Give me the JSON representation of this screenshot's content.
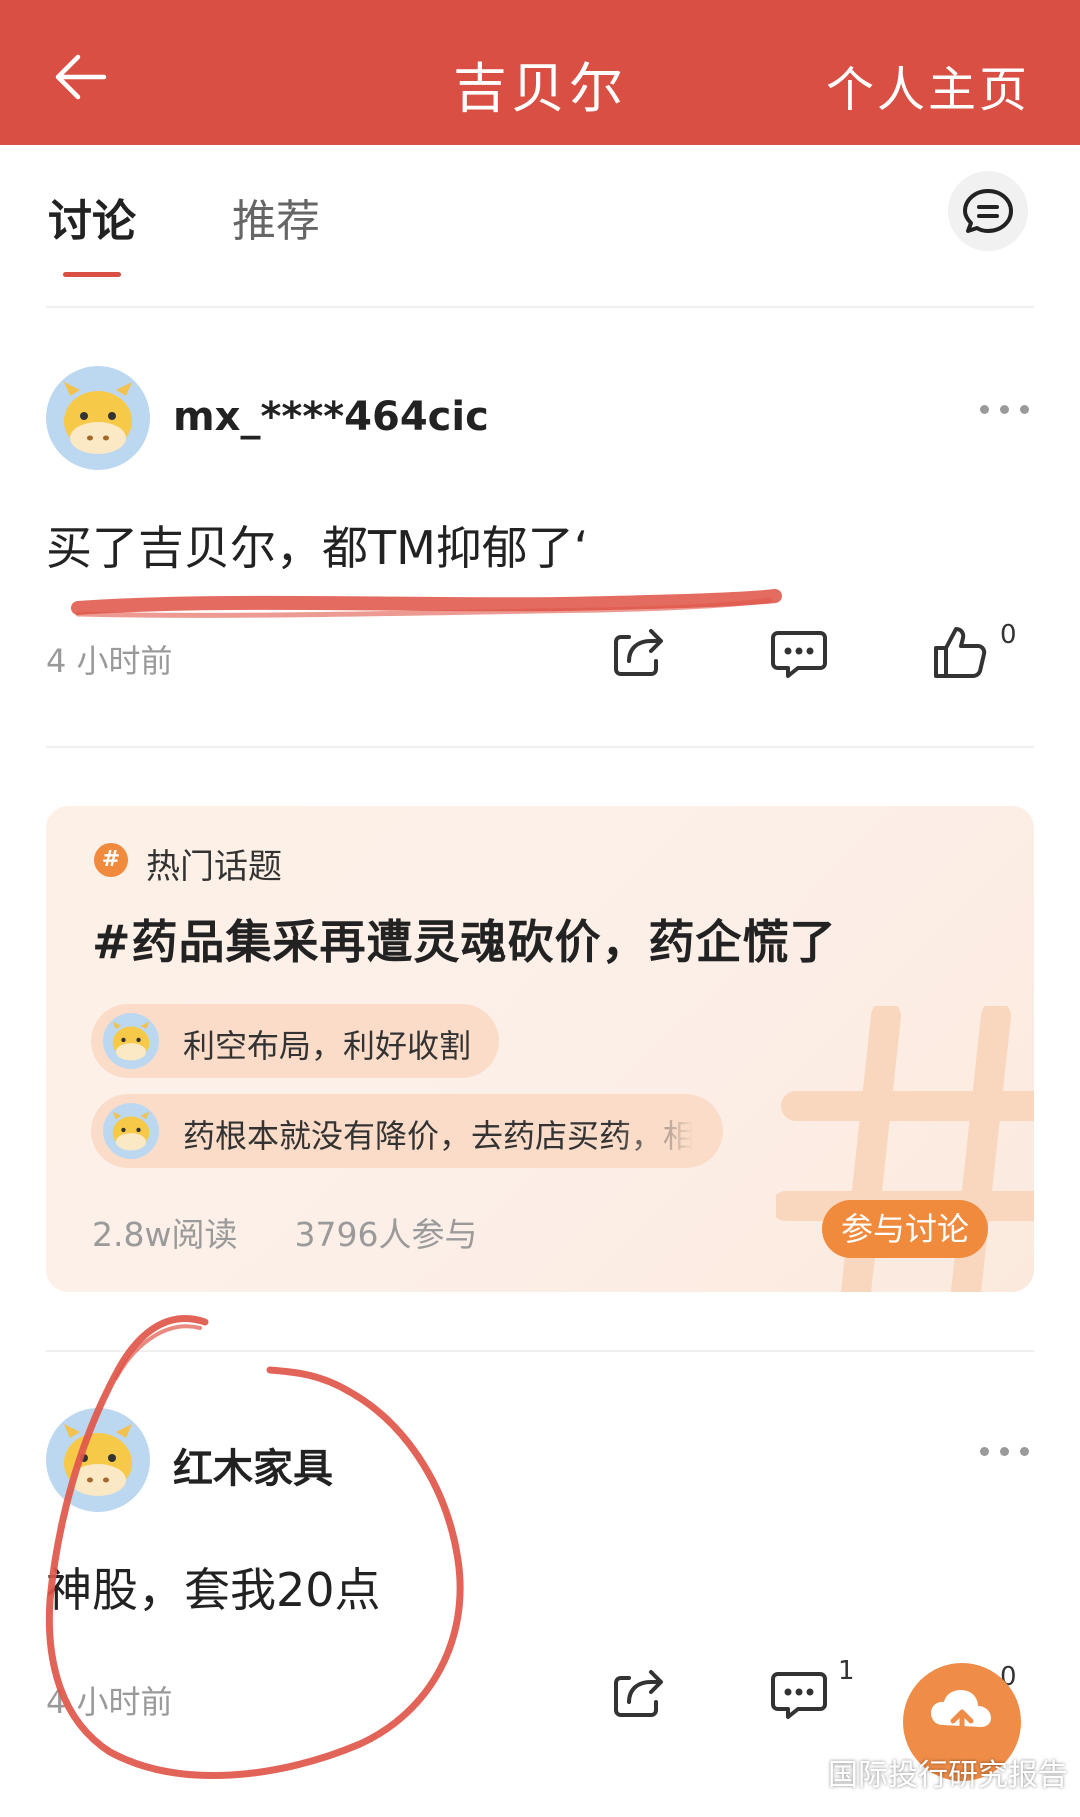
{
  "header": {
    "title": "吉贝尔",
    "right_label": "个人主页",
    "background": "#d94f43"
  },
  "tabs": [
    {
      "label": "讨论",
      "active": true
    },
    {
      "label": "推荐",
      "active": false
    }
  ],
  "posts": [
    {
      "username": "mx_****464cic",
      "content": "买了吉贝尔，都TM抑郁了‘",
      "time": "4 小时前",
      "comment_count": "",
      "like_count": "0"
    },
    {
      "username": "红木家具",
      "content": "神股，套我20点",
      "time": "4 小时前",
      "comment_count": "1",
      "like_count": "0"
    }
  ],
  "hot_topic": {
    "label": "热门话题",
    "title": "#药品集采再遭灵魂砍价，药企慌了",
    "comments": [
      "利空布局，利好收割",
      "药根本就没有降价，去药店买药，相"
    ],
    "reads": "2.8w阅读",
    "participants": "3796人参与",
    "join_label": "参与讨论",
    "accent": "#f08a3c"
  },
  "watermark": {
    "text": "国际投行研究报告"
  },
  "icons": {
    "back": "back-arrow-icon",
    "chat": "chat-bubble-icon",
    "share": "share-icon",
    "comment": "comment-icon",
    "like": "thumbs-up-icon",
    "more": "more-dots-icon"
  }
}
